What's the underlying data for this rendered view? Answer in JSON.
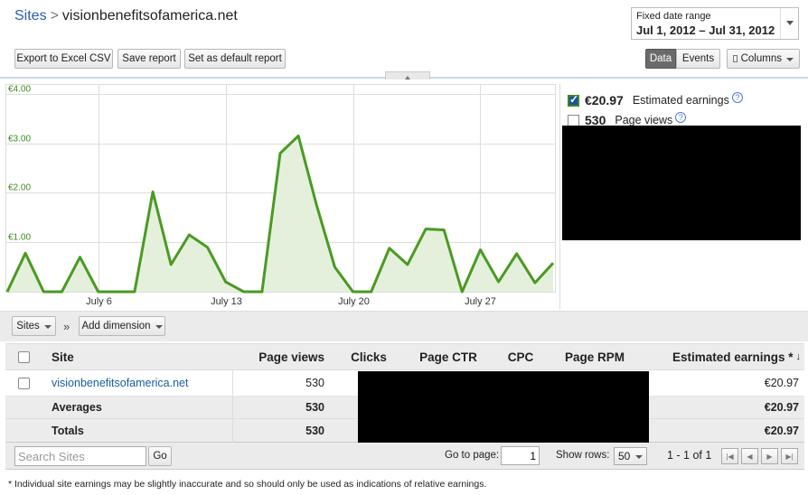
{
  "breadcrumb": {
    "root": "Sites",
    "separator": ">",
    "current": "visionbenefitsofamerica.net"
  },
  "date_range": {
    "label": "Fixed date range",
    "value": "Jul 1, 2012 – Jul 31, 2012"
  },
  "toolbar": {
    "export_label": "Export to Excel CSV",
    "save_label": "Save report",
    "default_label": "Set as default report",
    "data_label": "Data",
    "events_label": "Events",
    "columns_label": "Columns"
  },
  "legend": {
    "earnings_value": "€20.97",
    "earnings_label": "Estimated earnings",
    "earnings_checked": true,
    "pageviews_value": "530",
    "pageviews_label": "Page views",
    "pageviews_checked": false
  },
  "chart_data": {
    "type": "area",
    "series": [
      {
        "name": "Estimated earnings",
        "values": [
          0.0,
          0.78,
          0.0,
          0.0,
          0.7,
          0.0,
          0.0,
          0.0,
          2.02,
          0.55,
          1.15,
          0.9,
          0.2,
          0.0,
          0.0,
          2.8,
          3.15,
          1.75,
          0.5,
          0.0,
          0.0,
          0.88,
          0.55,
          1.27,
          1.25,
          0.0,
          0.85,
          0.2,
          0.77,
          0.18,
          0.58
        ]
      }
    ],
    "x": [
      1,
      2,
      3,
      4,
      5,
      6,
      7,
      8,
      9,
      10,
      11,
      12,
      13,
      14,
      15,
      16,
      17,
      18,
      19,
      20,
      21,
      22,
      23,
      24,
      25,
      26,
      27,
      28,
      29,
      30,
      31
    ],
    "x_tick_labels": [
      "July 6",
      "July 13",
      "July 20",
      "July 27"
    ],
    "x_tick_days": [
      6,
      13,
      20,
      27
    ],
    "y_tick_labels": [
      "€1.00",
      "€2.00",
      "€3.00",
      "€4.00"
    ],
    "y_tick_values": [
      1,
      2,
      3,
      4
    ],
    "ylim": [
      0,
      4.2
    ],
    "grid": true,
    "line_color": "#4a9a22",
    "fill_color": "#e4f0dc"
  },
  "dimensions": {
    "sites_label": "Sites",
    "arrow": "»",
    "add_label": "Add dimension"
  },
  "table": {
    "headers": {
      "site": "Site",
      "pageviews": "Page views",
      "clicks": "Clicks",
      "ctr": "Page CTR",
      "cpc": "CPC",
      "rpm": "Page RPM",
      "earnings": "Estimated earnings *",
      "sort": "↓"
    },
    "rows": [
      {
        "site": "visionbenefitsofamerica.net",
        "pageviews": "530",
        "earnings": "€20.97"
      }
    ],
    "averages": {
      "label": "Averages",
      "pageviews": "530",
      "earnings": "€20.97"
    },
    "totals": {
      "label": "Totals",
      "pageviews": "530",
      "earnings": "€20.97"
    }
  },
  "footer": {
    "search_placeholder": "Search Sites",
    "go_label": "Go",
    "goto_label": "Go to page:",
    "goto_value": "1",
    "show_rows_label": "Show rows:",
    "show_rows_value": "50",
    "range_text": "1 - 1 of 1"
  },
  "note": "* Individual site earnings may be slightly inaccurate and so should only be used as indications of relative earnings."
}
